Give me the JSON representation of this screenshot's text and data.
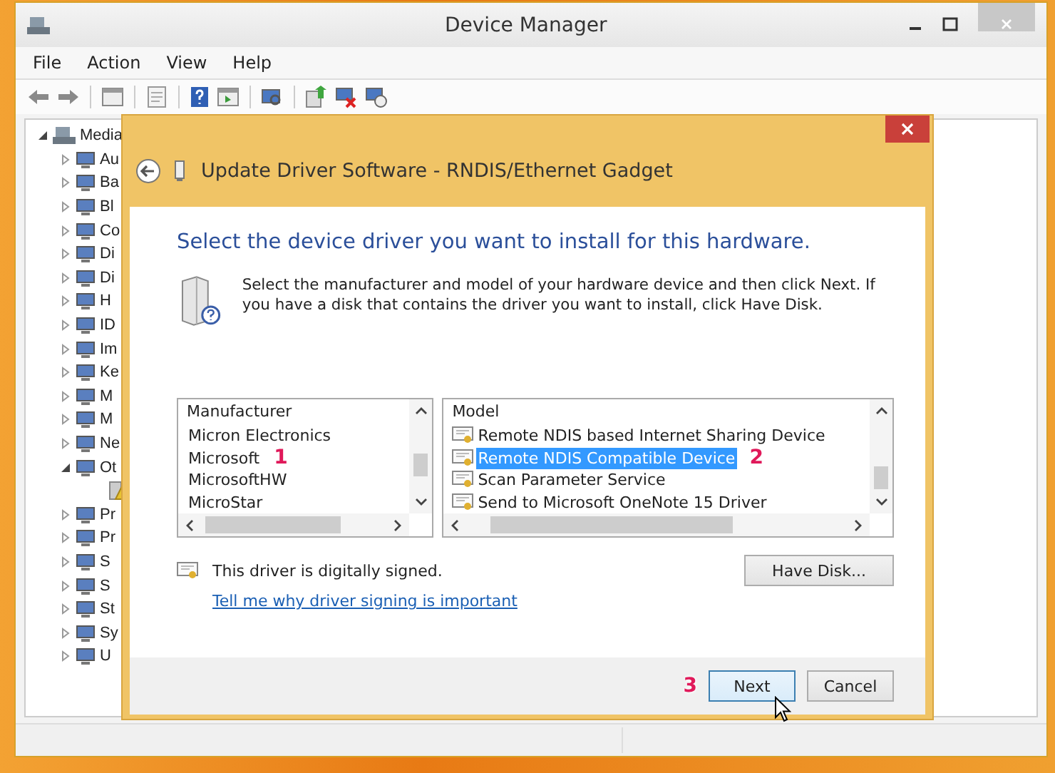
{
  "window": {
    "title": "Device Manager"
  },
  "menu": [
    "File",
    "Action",
    "View",
    "Help"
  ],
  "tree": {
    "label": "Media",
    "expanded": true,
    "children": [
      {
        "label": "Au",
        "expanded": false
      },
      {
        "label": "Ba",
        "expanded": false
      },
      {
        "label": "Bl",
        "expanded": false
      },
      {
        "label": "Co",
        "expanded": false
      },
      {
        "label": "Di",
        "expanded": false
      },
      {
        "label": "Di",
        "expanded": false
      },
      {
        "label": "H",
        "expanded": false
      },
      {
        "label": "ID",
        "expanded": false
      },
      {
        "label": "Im",
        "expanded": false
      },
      {
        "label": "Ke",
        "expanded": false
      },
      {
        "label": "M",
        "expanded": false
      },
      {
        "label": "M",
        "expanded": false
      },
      {
        "label": "Ne",
        "expanded": false
      },
      {
        "label": "Ot",
        "expanded": true,
        "children": [
          {
            "kind": "warning-device"
          }
        ]
      },
      {
        "label": "Pr",
        "expanded": false
      },
      {
        "label": "Pr",
        "expanded": false
      },
      {
        "label": "S",
        "expanded": false
      },
      {
        "label": "S",
        "expanded": false
      },
      {
        "label": "St",
        "expanded": false
      },
      {
        "label": "Sy",
        "expanded": false
      },
      {
        "label": "U",
        "expanded": false
      }
    ]
  },
  "dialog": {
    "title": "Update Driver Software - RNDIS/Ethernet Gadget",
    "heading": "Select the device driver you want to install for this hardware.",
    "instructions": "Select the manufacturer and model of your hardware device and then click Next. If you have a disk that contains the driver you want to install, click Have Disk.",
    "manufacturer_list": {
      "header": "Manufacturer",
      "items": [
        {
          "label": "Micron Electronics",
          "selected": false
        },
        {
          "label": "Microsoft",
          "selected": false,
          "callout": "1"
        },
        {
          "label": "MicrosoftHW",
          "selected": false
        },
        {
          "label": "MicroStar",
          "selected": false
        }
      ]
    },
    "model_list": {
      "header": "Model",
      "items": [
        {
          "label": "Remote NDIS based Internet Sharing Device",
          "selected": false
        },
        {
          "label": "Remote NDIS Compatible Device",
          "selected": true,
          "callout": "2"
        },
        {
          "label": "Scan Parameter Service",
          "selected": false
        },
        {
          "label": "Send to Microsoft OneNote 15 Driver",
          "selected": false
        }
      ]
    },
    "signed_note": "This driver is digitally signed.",
    "link": "Tell me why driver signing is important",
    "have_disk_button": "Have Disk...",
    "buttons": [
      {
        "label": "Next",
        "focused": true,
        "callout": "3"
      },
      {
        "label": "Cancel",
        "focused": false
      }
    ]
  }
}
